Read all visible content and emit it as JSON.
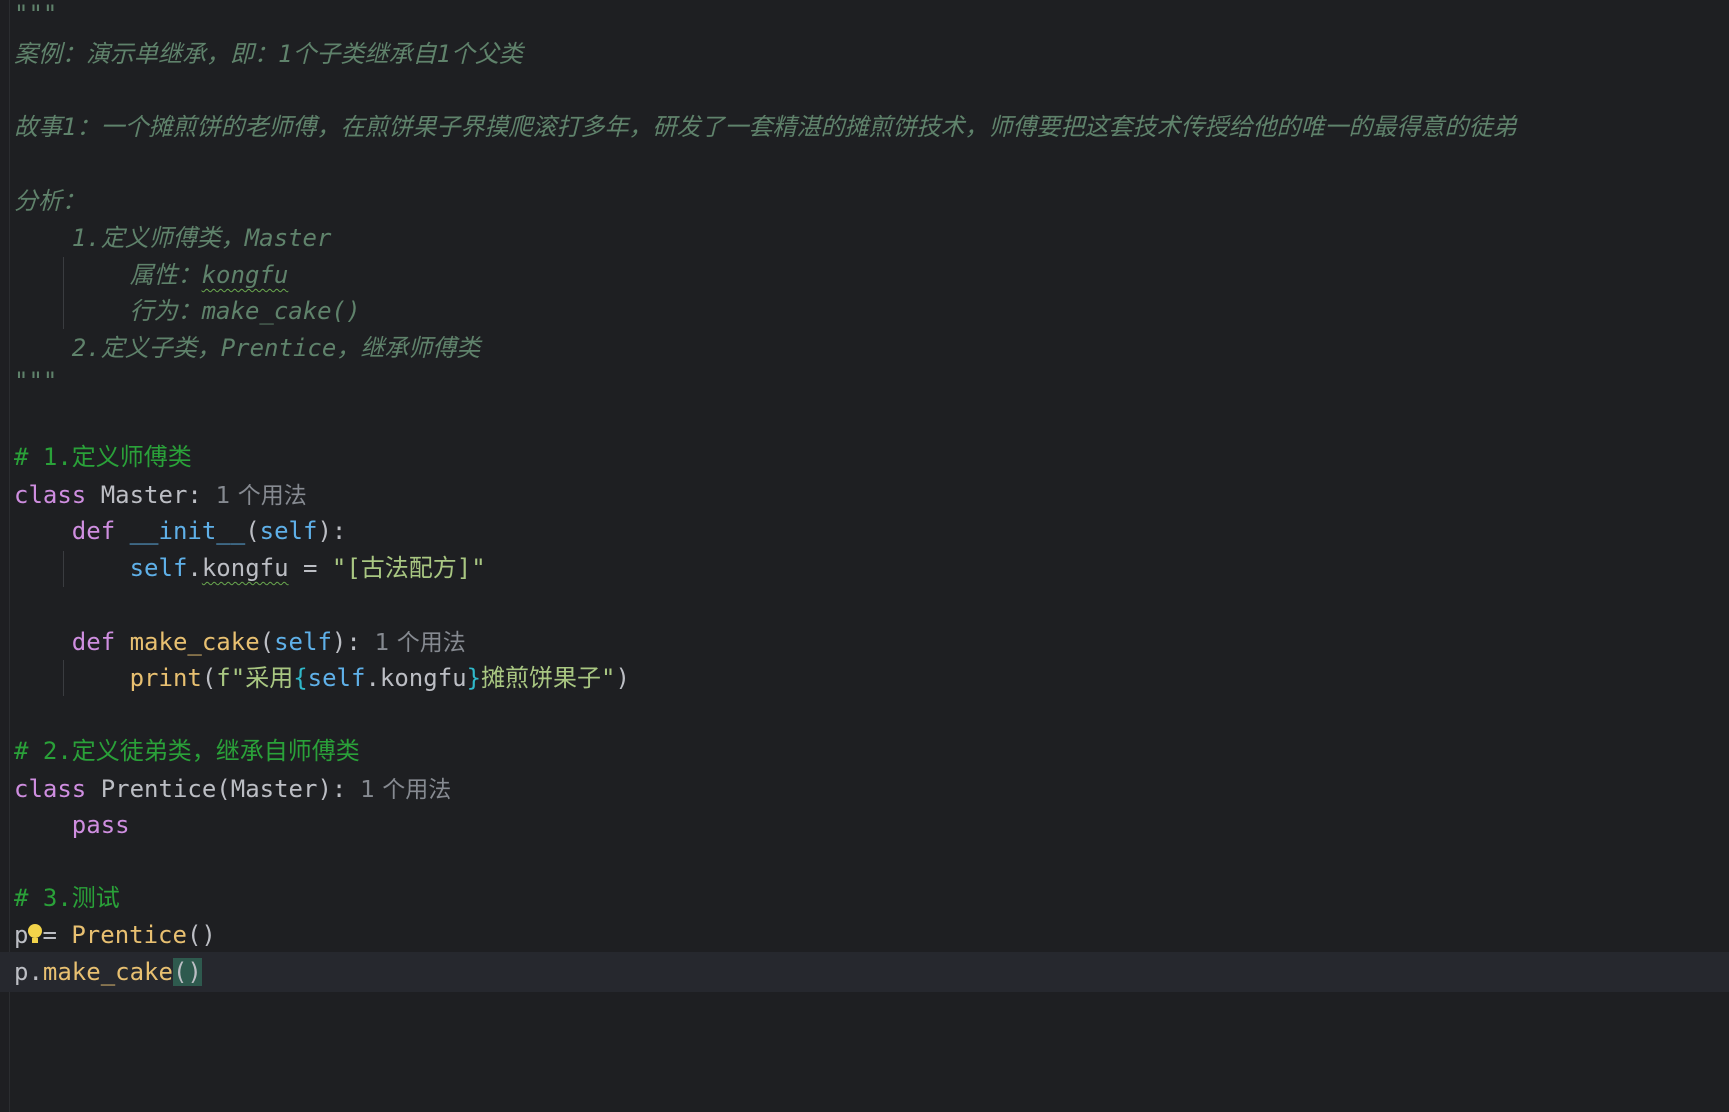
{
  "editor": {
    "language": "python",
    "lines": {
      "l1": "\"\"\"",
      "l2": "案例：演示单继承，即：1个子类继承自1个父类",
      "l4": "故事1：一个摊煎饼的老师傅，在煎饼果子界摸爬滚打多年，研发了一套精湛的摊煎饼技术，师傅要把这套技术传授给他的唯一的最得意的徒弟",
      "l6": "分析：",
      "l7": "    1.定义师傅类，Master",
      "l8_prefix": "        属性：",
      "l8_attr": "kongfu",
      "l9": "        行为：make_cake()",
      "l10": "    2.定义子类，Prentice，继承师傅类",
      "l11": "\"\"\"",
      "c1": "# 1.定义师傅类",
      "c2": "# 2.定义徒弟类，继承自师傅类",
      "c3": "# 3.测试"
    },
    "code": {
      "kw_class": "class",
      "kw_def": "def",
      "kw_pass": "pass",
      "master_name": "Master",
      "prentice_name": "Prentice",
      "init_name": "__init__",
      "make_cake_name": "make_cake",
      "self": "self",
      "kongfu": "kongfu",
      "init_value": "\"[古法配方]\"",
      "print": "print",
      "fstring_prefix": "f\"采用",
      "fstring_suffix": "摊煎饼果子\"",
      "var_p": "p",
      "paren_call": "()"
    },
    "hints": {
      "master_usages": "1 个用法",
      "make_cake_usages": "1 个用法",
      "prentice_usages": "1 个用法"
    },
    "current_line": "p.make_cake()"
  }
}
